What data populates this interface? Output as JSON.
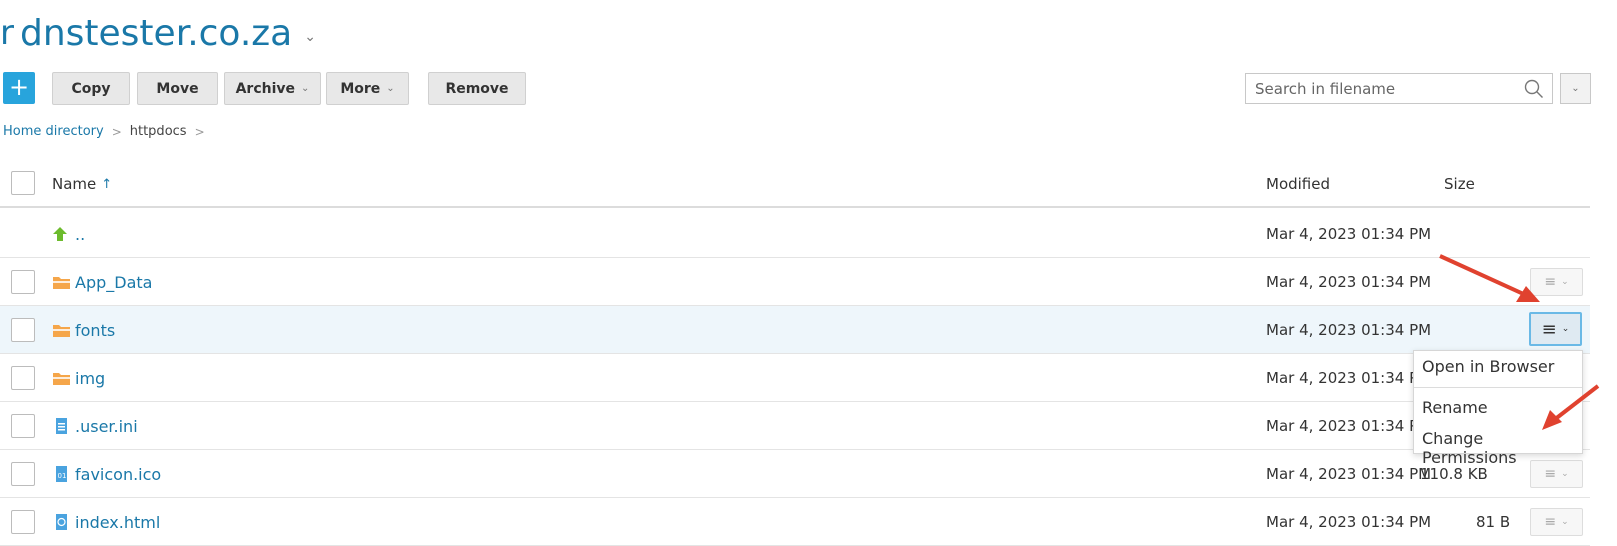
{
  "domain": {
    "lead_glyph": "r",
    "name": "dnstester.co.za",
    "chevron": "⌄"
  },
  "toolbar": {
    "add_label": "+",
    "copy_label": "Copy",
    "move_label": "Move",
    "archive_label": "Archive",
    "more_label": "More",
    "remove_label": "Remove",
    "dropdown_glyph": "⌄"
  },
  "search": {
    "placeholder": "Search in filename"
  },
  "breadcrumb": {
    "home": "Home directory",
    "current": "httpdocs",
    "sep": ">"
  },
  "table": {
    "columns": {
      "name": "Name",
      "sort_indicator": "↑",
      "modified": "Modified",
      "size": "Size"
    },
    "rows": [
      {
        "name": "..",
        "modified": "Mar 4, 2023 01:34 PM",
        "size": "",
        "icon": "parent-up-icon"
      },
      {
        "name": "App_Data",
        "modified": "Mar 4, 2023 01:34 PM",
        "size": "",
        "icon": "folder-icon"
      },
      {
        "name": "fonts",
        "modified": "Mar 4, 2023 01:34 PM",
        "size": "",
        "icon": "folder-icon"
      },
      {
        "name": "img",
        "modified": "Mar 4, 2023 01:34 P",
        "size": "",
        "icon": "folder-icon"
      },
      {
        "name": ".user.ini",
        "modified": "Mar 4, 2023 01:34 P",
        "size": "",
        "icon": "text-file-icon"
      },
      {
        "name": "favicon.ico",
        "modified": "Mar 4, 2023 01:34 PM",
        "size": "110.8 KB",
        "icon": "binary-file-icon"
      },
      {
        "name": "index.html",
        "modified": "Mar 4, 2023 01:34 PM",
        "size": "81 B",
        "icon": "html-file-icon"
      }
    ]
  },
  "context_menu": {
    "open_in_browser": "Open in Browser",
    "rename": "Rename",
    "change_permissions": "Change Permissions"
  },
  "colors": {
    "accent": "#1a78a8",
    "add_button": "#28a4dc",
    "folder": "#f5a64a",
    "annotation_arrow": "#e0422f"
  }
}
